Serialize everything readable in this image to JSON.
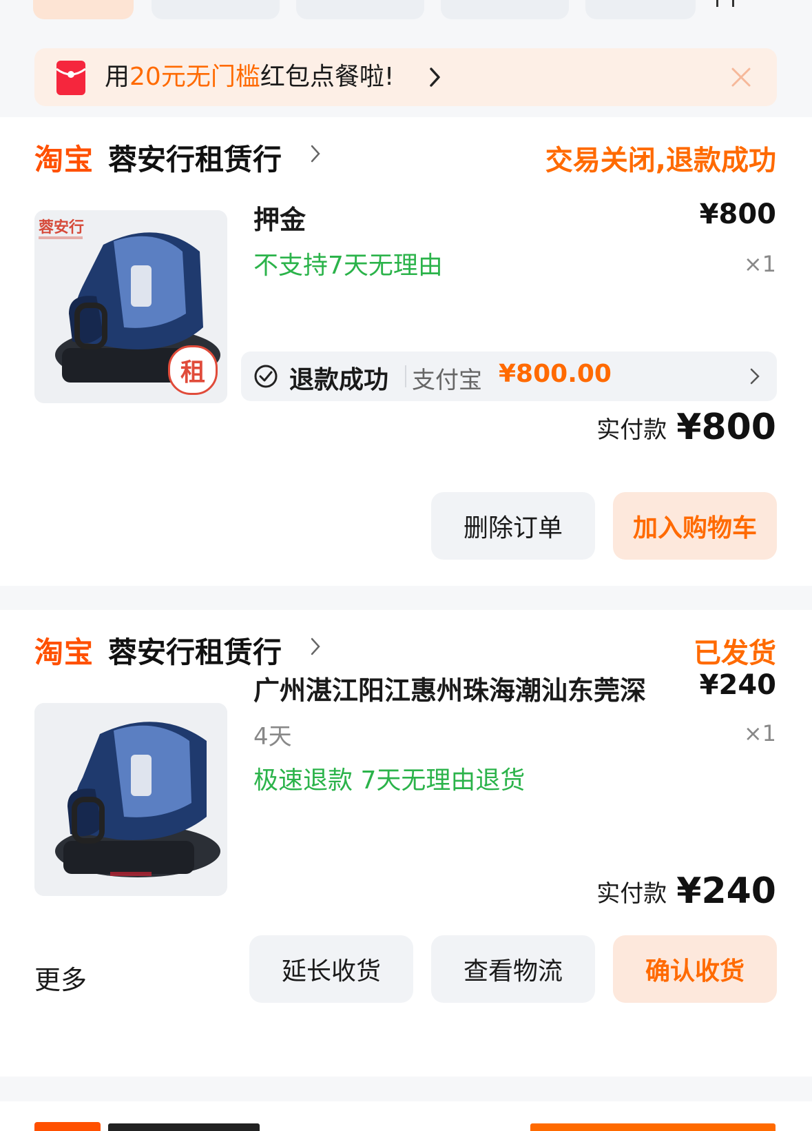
{
  "coupon": {
    "prefix": "用",
    "highlight": "20元无门槛",
    "suffix": "红包点餐啦!"
  },
  "orders": [
    {
      "platform": "淘宝",
      "shop": "蓉安行租赁行",
      "status": "交易关闭,退款成功",
      "item": {
        "title": "押金",
        "tag": "不支持7天无理由",
        "price": "¥800",
        "qty": "×1",
        "thumb_brand": "蓉安行",
        "thumb_badge": "租"
      },
      "refund": {
        "label": "退款成功",
        "method": "支付宝",
        "amount": "¥800.00"
      },
      "paid_label": "实付款",
      "paid_amount": "¥800",
      "buttons": [
        "删除订单",
        "加入购物车"
      ]
    },
    {
      "platform": "淘宝",
      "shop": "蓉安行租赁行",
      "status": "已发货",
      "item": {
        "title": "广州湛江阳江惠州珠海潮汕东莞深",
        "spec": "4天",
        "tag": "极速退款  7天无理由退货",
        "price": "¥240",
        "qty": "×1"
      },
      "paid_label": "实付款",
      "paid_amount": "¥240",
      "more": "更多",
      "buttons": [
        "延长收货",
        "查看物流",
        "确认收货"
      ]
    }
  ],
  "colors": {
    "accent": "#ff6a00",
    "taobao": "#ff5000",
    "green": "#2bb34a"
  }
}
